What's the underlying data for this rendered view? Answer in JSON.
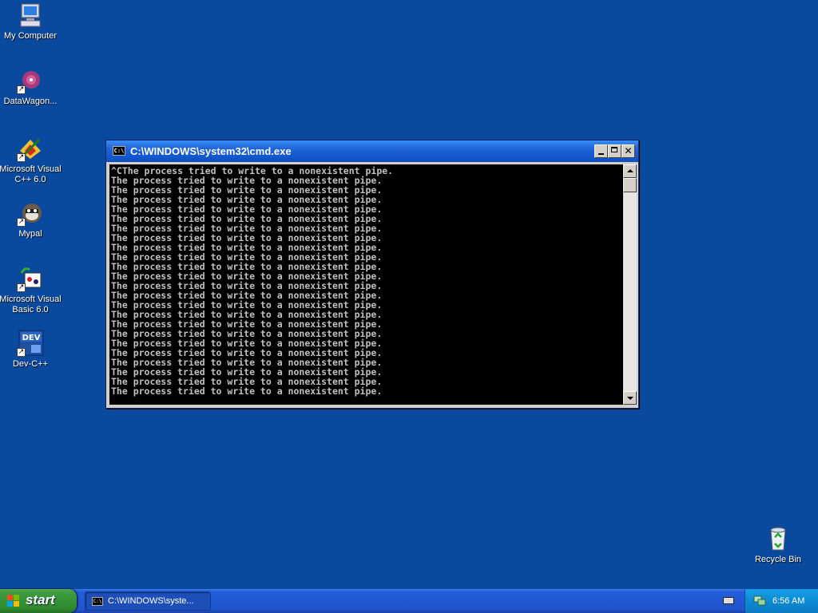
{
  "desktop": {
    "icons": [
      {
        "label": "My Computer",
        "icon": "my-computer-icon"
      },
      {
        "label": "DataWagon...",
        "icon": "datawagon-icon"
      },
      {
        "label": "Microsoft Visual C++ 6.0",
        "icon": "visual-cpp-icon"
      },
      {
        "label": "Mypal",
        "icon": "mypal-icon"
      },
      {
        "label": "Microsoft Visual Basic 6.0",
        "icon": "visual-basic-icon"
      },
      {
        "label": "Dev-C++",
        "icon": "dev-cpp-icon"
      },
      {
        "label": "Recycle Bin",
        "icon": "recycle-bin-icon"
      }
    ],
    "background_color": "#0a4a9e"
  },
  "cmd_window": {
    "title": "C:\\WINDOWS\\system32\\cmd.exe",
    "icon_text": "C:\\",
    "close_symbol": "✕",
    "lines": [
      "^CThe process tried to write to a nonexistent pipe.",
      "The process tried to write to a nonexistent pipe.",
      "The process tried to write to a nonexistent pipe.",
      "The process tried to write to a nonexistent pipe.",
      "The process tried to write to a nonexistent pipe.",
      "The process tried to write to a nonexistent pipe.",
      "The process tried to write to a nonexistent pipe.",
      "The process tried to write to a nonexistent pipe.",
      "The process tried to write to a nonexistent pipe.",
      "The process tried to write to a nonexistent pipe.",
      "The process tried to write to a nonexistent pipe.",
      "The process tried to write to a nonexistent pipe.",
      "The process tried to write to a nonexistent pipe.",
      "The process tried to write to a nonexistent pipe.",
      "The process tried to write to a nonexistent pipe.",
      "The process tried to write to a nonexistent pipe.",
      "The process tried to write to a nonexistent pipe.",
      "The process tried to write to a nonexistent pipe.",
      "The process tried to write to a nonexistent pipe.",
      "The process tried to write to a nonexistent pipe.",
      "The process tried to write to a nonexistent pipe.",
      "The process tried to write to a nonexistent pipe.",
      "The process tried to write to a nonexistent pipe.",
      "The process tried to write to a nonexistent pipe."
    ]
  },
  "taskbar": {
    "start_label": "start",
    "task_button_label": "C:\\WINDOWS\\syste...",
    "clock": "6:56 AM"
  }
}
